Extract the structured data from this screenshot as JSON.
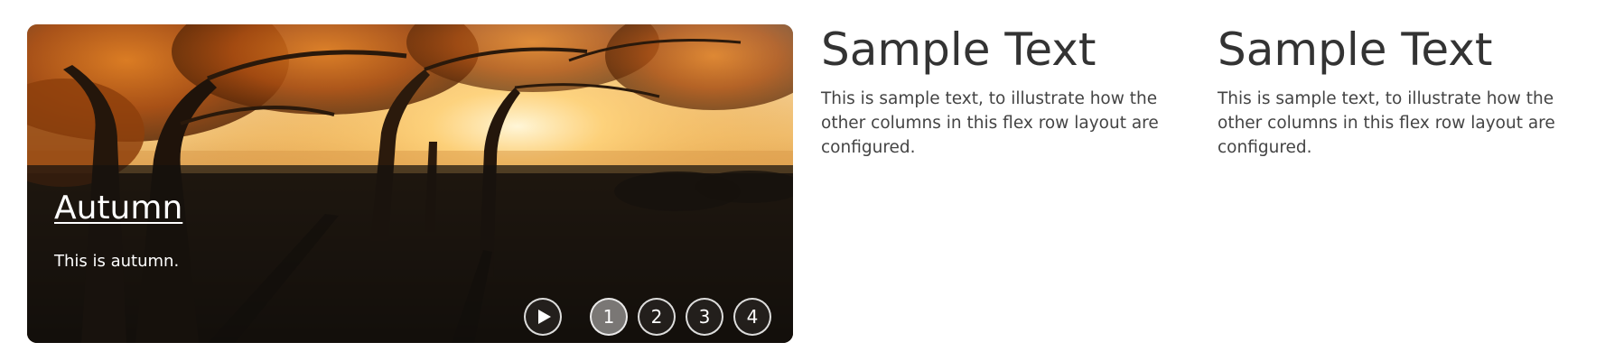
{
  "slider": {
    "slide": {
      "title": "Autumn",
      "text": "This is autumn."
    },
    "controls": {
      "play_icon": "play-icon",
      "pages": [
        "1",
        "2",
        "3",
        "4"
      ],
      "active_page": "1"
    }
  },
  "columns": [
    {
      "heading": "Sample Text",
      "body": "This is sample text, to illustrate how the other columns in this flex row layout are configured."
    },
    {
      "heading": "Sample Text",
      "body": "This is sample text, to illustrate how the other columns in this flex row layout are configured."
    }
  ],
  "colors": {
    "text": "#333333",
    "caption_overlay": "#14100e",
    "active_page_bg": "#8c8a88"
  }
}
